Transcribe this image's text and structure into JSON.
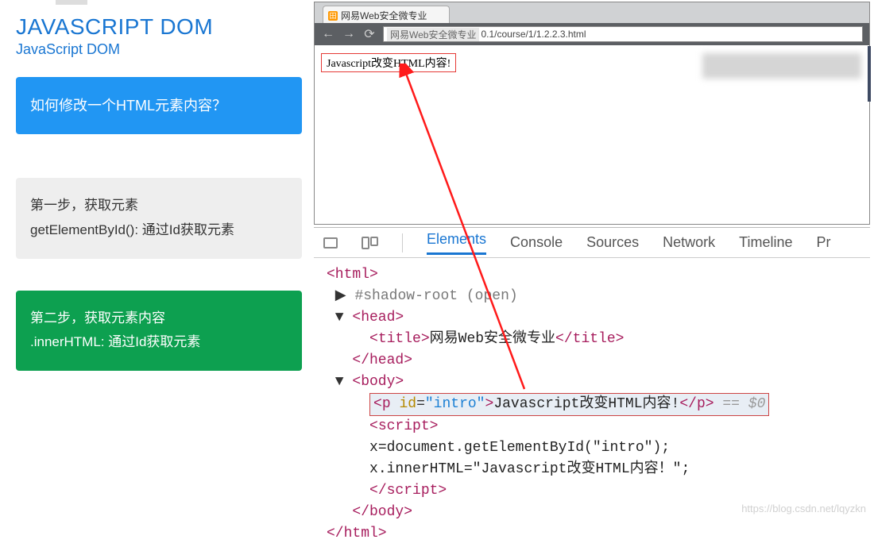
{
  "slide": {
    "title": "JAVASCRIPT DOM",
    "subtitle": "JavaScript DOM",
    "question": "如何修改一个HTML元素内容？",
    "step1_line1": "第一步，获取元素",
    "step1_line2": "getElementById(): 通过Id获取元素",
    "step2_line1": "第二步，获取元素内容",
    "step2_line2": ".innerHTML: 通过Id获取元素"
  },
  "browser": {
    "tab_title": "网易Web安全微专业",
    "url_prefix": "网易Web安全微专业",
    "url_suffix": "0.1/course/1/1.2.2.3.html",
    "page_output": "Javascript改变HTML内容!"
  },
  "devtools": {
    "tabs": {
      "elements": "Elements",
      "console": "Console",
      "sources": "Sources",
      "network": "Network",
      "timeline": "Timeline",
      "more": "Pr"
    },
    "dom": {
      "html_open": "<html>",
      "shadow": "#shadow-root (open)",
      "head_open": "<head>",
      "title_open": "<title>",
      "title_text": "网易Web安全微专业",
      "title_close": "</title>",
      "head_close": "</head>",
      "body_open": "<body>",
      "p_open_tag": "p",
      "p_attr_name": "id",
      "p_attr_val": "\"intro\"",
      "p_text": "Javascript改变HTML内容!",
      "p_close": "</p>",
      "eq": " == $0",
      "script_open": "<script>",
      "js_line1": "x=document.getElementById(\"intro\");",
      "js_line2": "x.innerHTML=\"Javascript改变HTML内容！\";",
      "script_close": "</script>",
      "body_close": "</body>",
      "html_close": "</html>"
    }
  },
  "watermark": "https://blog.csdn.net/lqyzkn"
}
